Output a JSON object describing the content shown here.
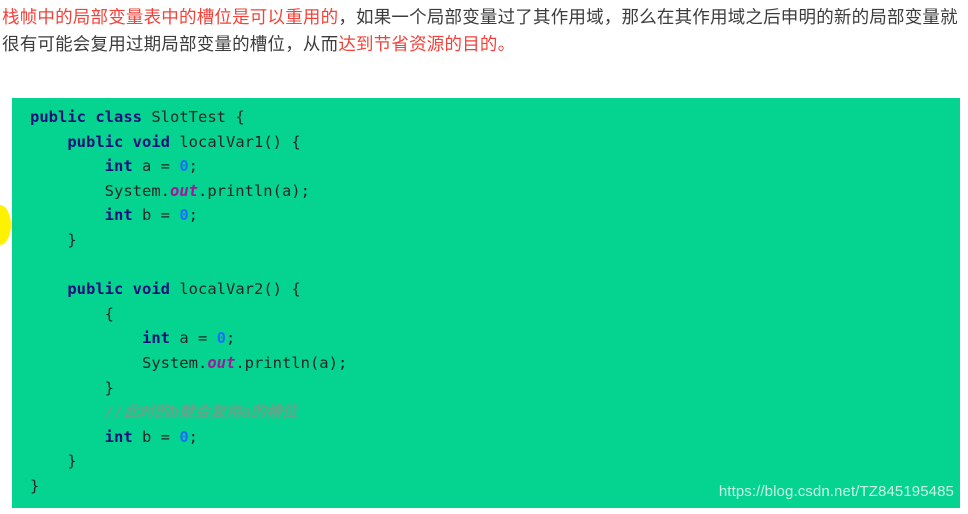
{
  "prose": {
    "segments": [
      {
        "text": "栈帧中的局部变量表中的槽位是可以重用的",
        "highlight": true
      },
      {
        "text": "，如果一个局部变量过了其作用域，那么在其作用域之后申明的新的局部变量就很有可能会复用过期局部变量的槽位，从而",
        "highlight": false
      },
      {
        "text": "达到节省资源的目的。",
        "highlight": true
      }
    ],
    "highlight_color": "#f2423a",
    "text_color": "#3c3c3c"
  },
  "code": {
    "language": "java",
    "background_color": "#05d491",
    "keyword_color": "#16117a",
    "number_color": "#1a6ff5",
    "field_color": "#9c1a9c",
    "comment_color": "#63a48a",
    "lines": [
      "public class SlotTest {",
      "    public void localVar1() {",
      "        int a = 0;",
      "        System.out.println(a);",
      "        int b = 0;",
      "    }",
      "",
      "    public void localVar2() {",
      "        {",
      "            int a = 0;",
      "            System.out.println(a);",
      "        }",
      "        //此时的b就会复用a的槽位",
      "        int b = 0;",
      "    }",
      "}"
    ],
    "tokens": {
      "l1": {
        "kw1": "public",
        "kw2": "class",
        "name": " SlotTest {"
      },
      "l2": {
        "indent": "    ",
        "kw1": "public",
        "kw2": "void",
        "name": " localVar1() {"
      },
      "l3": {
        "indent": "        ",
        "kw": "int",
        "mid": " a = ",
        "num": "0",
        "end": ";"
      },
      "l4": {
        "indent": "        ",
        "pre": "System.",
        "fld": "out",
        "post": ".println(a);"
      },
      "l5": {
        "indent": "        ",
        "kw": "int",
        "mid": " b = ",
        "num": "0",
        "end": ";"
      },
      "l6": {
        "text": "    }"
      },
      "l7": {
        "text": ""
      },
      "l8": {
        "indent": "    ",
        "kw1": "public",
        "kw2": "void",
        "name": " localVar2() {"
      },
      "l9": {
        "text": "        {"
      },
      "l10": {
        "indent": "            ",
        "kw": "int",
        "mid": " a = ",
        "num": "0",
        "end": ";"
      },
      "l11": {
        "indent": "            ",
        "pre": "System.",
        "fld": "out",
        "post": ".println(a);"
      },
      "l12": {
        "text": "        }"
      },
      "l13": {
        "indent": "        ",
        "comment": "//此时的b就会复用a的槽位"
      },
      "l14": {
        "indent": "        ",
        "kw": "int",
        "mid": " b = ",
        "num": "0",
        "end": ";"
      },
      "l15": {
        "text": "    }"
      },
      "l16": {
        "text": "}"
      }
    }
  },
  "cursor": {
    "name": "yellow-highlight-dot",
    "color": "#fff200"
  },
  "watermark": {
    "url": "https://blog.csdn.net/TZ845195485"
  }
}
